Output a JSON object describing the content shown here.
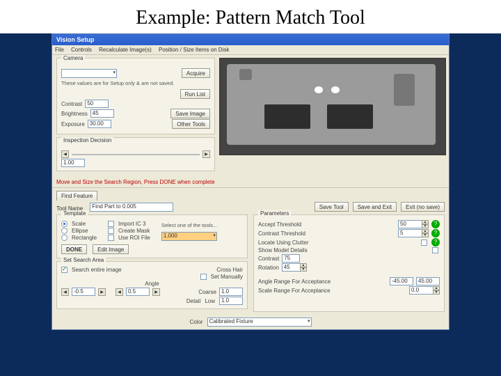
{
  "slide": {
    "title": "Example: Pattern Match Tool"
  },
  "window": {
    "title": "Vision Setup"
  },
  "menubar": {
    "items": [
      "File",
      "Controls",
      "Recalculate Image(s)",
      "Position / Size Items on Disk"
    ]
  },
  "camera_group": {
    "title": "Camera",
    "note": "These values are for Setup only & are not saved.",
    "contrast_label": "Contrast",
    "brightness_label": "Brightness",
    "exposure_label": "Exposure",
    "contrast_value": "50",
    "brightness_value": "45",
    "exposure_value": "30.00",
    "acquire_button": "Acquire",
    "run_list_button": "Run List",
    "save_image_button": "Save Image",
    "other_tools_button": "Other Tools"
  },
  "inspection_group": {
    "title": "Inspection Decision",
    "value": "1.00"
  },
  "warning": "Move and Size the Search Region, Press DONE when complete",
  "tabs": {
    "tool_name_label": "Tool Name",
    "tool_name_value": "Find Part to 0.005",
    "save_tool": "Save Tool",
    "save_and_exit": "Save and Exit",
    "exit_no_save": "Exit (no save)",
    "find_feature": "Find Feature"
  },
  "template_group": {
    "title": "Template",
    "scale_label": "Scale",
    "ellipse_label": "Ellipse",
    "rectangle_label": "Rectangle",
    "imprint_label": "Import IC 3",
    "create_mask_label": "Create Mask",
    "use_roi_label": "Use ROI File",
    "sel_text": "Select one of the tools…",
    "sel_value": "1.000",
    "done_button": "DONE",
    "edit_image_button": "Edit Image"
  },
  "search_group": {
    "title": "Set Search Area",
    "search_entire_label": "Search entire image",
    "cross_hair_label": "Cross Hair",
    "set_manually_label": "Set Manually",
    "angle_label": "Angle",
    "coarse_label": "Coarse",
    "detail_label": "Detail",
    "low_label": "Low",
    "coarse_value": "1.0",
    "angle_low": "-0.5",
    "angle_high": "0.5",
    "detail_value": "1.0"
  },
  "parameters_group": {
    "title": "Parameters",
    "accept_thresh_label": "Accept Threshold",
    "contrast_thresh_label": "Contrast Threshold",
    "locate_using_label": "Locate Using Clutter",
    "show_model_label": "Show Model Details",
    "contrast_label": "Contrast",
    "rotation_label": "Rotation",
    "angle_range_label": "Angle Range For Acceptance",
    "scale_range_label": "Scale Range For Acceptance",
    "accept_thresh_value": "50",
    "contrast_thresh_value": "5",
    "contrast_value": "75",
    "rotation_value": "45",
    "angle_low": "-45.00",
    "angle_high": "45.00",
    "scale_value": "0.0"
  },
  "bottom": {
    "color_label": "Color",
    "color_value": "Calibrated Fixture"
  }
}
